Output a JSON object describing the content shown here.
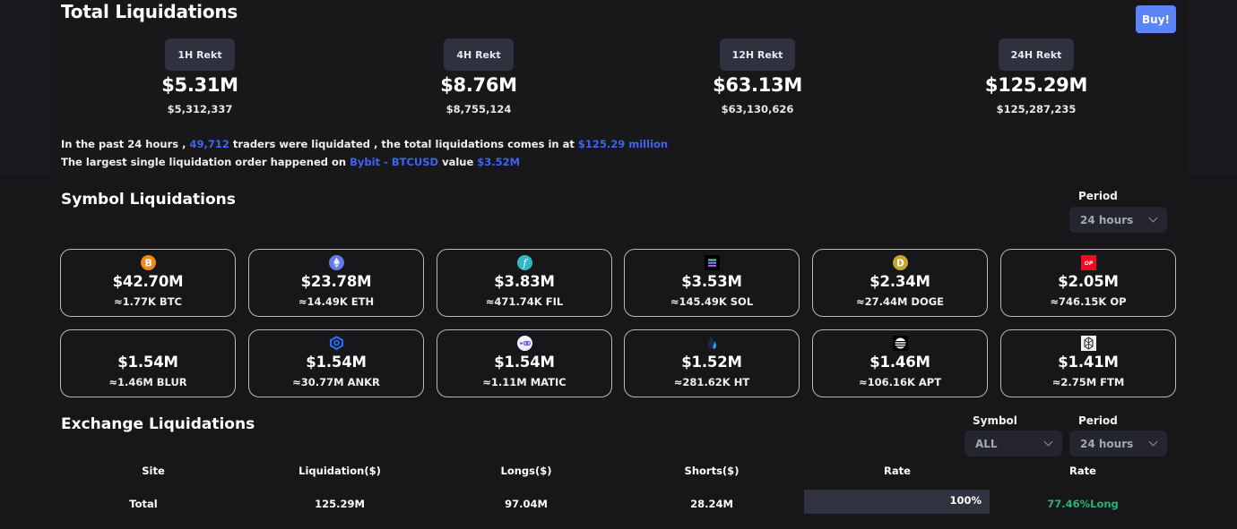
{
  "total": {
    "title": "Total Liquidations",
    "buy_label": "Buy!",
    "periods": [
      {
        "label": "1H Rekt",
        "short": "$5.31M",
        "full": "$5,312,337"
      },
      {
        "label": "4H Rekt",
        "short": "$8.76M",
        "full": "$8,755,124"
      },
      {
        "label": "12H Rekt",
        "short": "$63.13M",
        "full": "$63,130,626"
      },
      {
        "label": "24H Rekt",
        "short": "$125.29M",
        "full": "$125,287,235"
      }
    ],
    "summary1": {
      "pre": "In the past 24 hours ,",
      "traders": "49,712",
      "mid": "traders were liquidated , the total liquidations comes in at",
      "total": "$125.29 million"
    },
    "summary2": {
      "pre": "The largest single liquidation order happened on",
      "exchange": "Bybit - BTCUSD",
      "mid": "value",
      "value": "$3.52M"
    }
  },
  "symbol": {
    "title": "Symbol Liquidations",
    "period_label": "Period",
    "period_value": "24 hours",
    "cards": [
      {
        "symbol": "BTC",
        "icon": "bitcoin-icon",
        "value": "$42.70M",
        "amount": "≈1.77K BTC"
      },
      {
        "symbol": "ETH",
        "icon": "ethereum-icon",
        "value": "$23.78M",
        "amount": "≈14.49K ETH"
      },
      {
        "symbol": "FIL",
        "icon": "filecoin-icon",
        "value": "$3.83M",
        "amount": "≈471.74K FIL"
      },
      {
        "symbol": "SOL",
        "icon": "solana-icon",
        "value": "$3.53M",
        "amount": "≈145.49K SOL"
      },
      {
        "symbol": "DOGE",
        "icon": "dogecoin-icon",
        "value": "$2.34M",
        "amount": "≈27.44M DOGE"
      },
      {
        "symbol": "OP",
        "icon": "optimism-icon",
        "value": "$2.05M",
        "amount": "≈746.15K OP"
      },
      {
        "symbol": "BLUR",
        "icon": "blur-icon",
        "value": "$1.54M",
        "amount": "≈1.46M BLUR"
      },
      {
        "symbol": "ANKR",
        "icon": "ankr-icon",
        "value": "$1.54M",
        "amount": "≈30.77M ANKR"
      },
      {
        "symbol": "MATIC",
        "icon": "polygon-icon",
        "value": "$1.54M",
        "amount": "≈1.11M MATIC"
      },
      {
        "symbol": "HT",
        "icon": "huobi-token-icon",
        "value": "$1.52M",
        "amount": "≈281.62K HT"
      },
      {
        "symbol": "APT",
        "icon": "aptos-icon",
        "value": "$1.46M",
        "amount": "≈106.16K APT"
      },
      {
        "symbol": "FTM",
        "icon": "fantom-icon",
        "value": "$1.41M",
        "amount": "≈2.75M FTM"
      }
    ]
  },
  "exchange": {
    "title": "Exchange Liquidations",
    "symbol_label": "Symbol",
    "symbol_value": "ALL",
    "period_label": "Period",
    "period_value": "24 hours",
    "columns": [
      "Site",
      "Liquidation($)",
      "Longs($)",
      "Shorts($)",
      "Rate",
      "Rate"
    ],
    "rows": [
      {
        "site": "Total",
        "liquidation": "125.29M",
        "longs": "97.04M",
        "shorts": "28.24M",
        "rate_pct": 100,
        "rate_label": "100%",
        "long_rate": "77.46%Long"
      }
    ]
  },
  "colors": {
    "accent": "#5b84f7",
    "highlight": "#3f63f1",
    "long_green": "#23b576",
    "badge_bg": "#30313f"
  }
}
